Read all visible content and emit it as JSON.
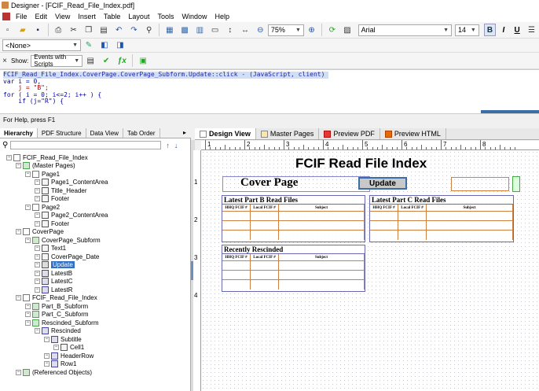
{
  "window": {
    "title": "Designer - [FCIF_Read_File_Index.pdf]"
  },
  "menu": [
    "File",
    "Edit",
    "View",
    "Insert",
    "Table",
    "Layout",
    "Tools",
    "Window",
    "Help"
  ],
  "toolbar1": {
    "zoom": "75%",
    "font": "Arial",
    "font_size": "14"
  },
  "toolbar2": {
    "style_combo": "<None>"
  },
  "script_toolbar": {
    "show_label": "Show:",
    "show_value": "Events with Scripts"
  },
  "script": {
    "line1": "FCIF_Read_File_Index.CoverPage.CoverPage_Subform.Update::click - (JavaScript, client)",
    "line2": "var i = 0,",
    "line3": "    j = \"B\";",
    "line4": "for ( i = 0; i<=2; i++ ) {",
    "line5": "    if (j=\"R\") {"
  },
  "status": "For Help, press F1",
  "left_tabs": [
    "Hierarchy",
    "PDF Structure",
    "Data View",
    "Tab Order"
  ],
  "tree": [
    {
      "label": "FCIF_Read_File_Index",
      "level": 0
    },
    {
      "label": "(Master Pages)",
      "level": 1
    },
    {
      "label": "Page1",
      "level": 2
    },
    {
      "label": "Page1_ContentArea",
      "level": 3
    },
    {
      "label": "Title_Header",
      "level": 3
    },
    {
      "label": "Footer",
      "level": 3
    },
    {
      "label": "Page2",
      "level": 2
    },
    {
      "label": "Page2_ContentArea",
      "level": 3
    },
    {
      "label": "Footer",
      "level": 3
    },
    {
      "label": "CoverPage",
      "level": 1
    },
    {
      "label": "CoverPage_Subform",
      "level": 2
    },
    {
      "label": "Text1",
      "level": 3
    },
    {
      "label": "CoverPage_Date",
      "level": 3
    },
    {
      "label": "Update",
      "level": 3
    },
    {
      "label": "LatestB",
      "level": 3
    },
    {
      "label": "LatestC",
      "level": 3
    },
    {
      "label": "LatestR",
      "level": 3
    },
    {
      "label": "FCIF_Read_File_Index",
      "level": 1
    },
    {
      "label": "Part_B_Subform",
      "level": 2
    },
    {
      "label": "Part_C_Subform",
      "level": 2
    },
    {
      "label": "Rescinded_Subform",
      "level": 2
    },
    {
      "label": "Rescinded",
      "level": 3
    },
    {
      "label": "Subtitle",
      "level": 4
    },
    {
      "label": "Cell1",
      "level": 5
    },
    {
      "label": "HeaderRow",
      "level": 4
    },
    {
      "label": "Row1",
      "level": 4
    },
    {
      "label": "(Referenced Objects)",
      "level": 1
    }
  ],
  "design_tabs": [
    "Design View",
    "Master Pages",
    "Preview PDF",
    "Preview HTML"
  ],
  "ruler_numbers": [
    "1",
    "2",
    "3",
    "4",
    "5",
    "6",
    "7",
    "8"
  ],
  "ruler_left_numbers": [
    "1",
    "2",
    "3",
    "4"
  ],
  "form": {
    "title": "FCIF Read File Index",
    "cover_page": "Cover Page",
    "update_button": "Update",
    "table_b": {
      "title": "Latest Part B Read Files",
      "headers": [
        "HHQ FCIF #",
        "Local FCIF #",
        "Subject"
      ]
    },
    "table_c": {
      "title": "Latest Part C Read Files",
      "headers": [
        "HHQ FCIF #",
        "Local FCIF #",
        "Subject"
      ]
    },
    "table_r": {
      "title": "Recently Rescinded",
      "headers": [
        "HHQ FCIF #",
        "Local FCIF #",
        "Subject"
      ]
    }
  }
}
